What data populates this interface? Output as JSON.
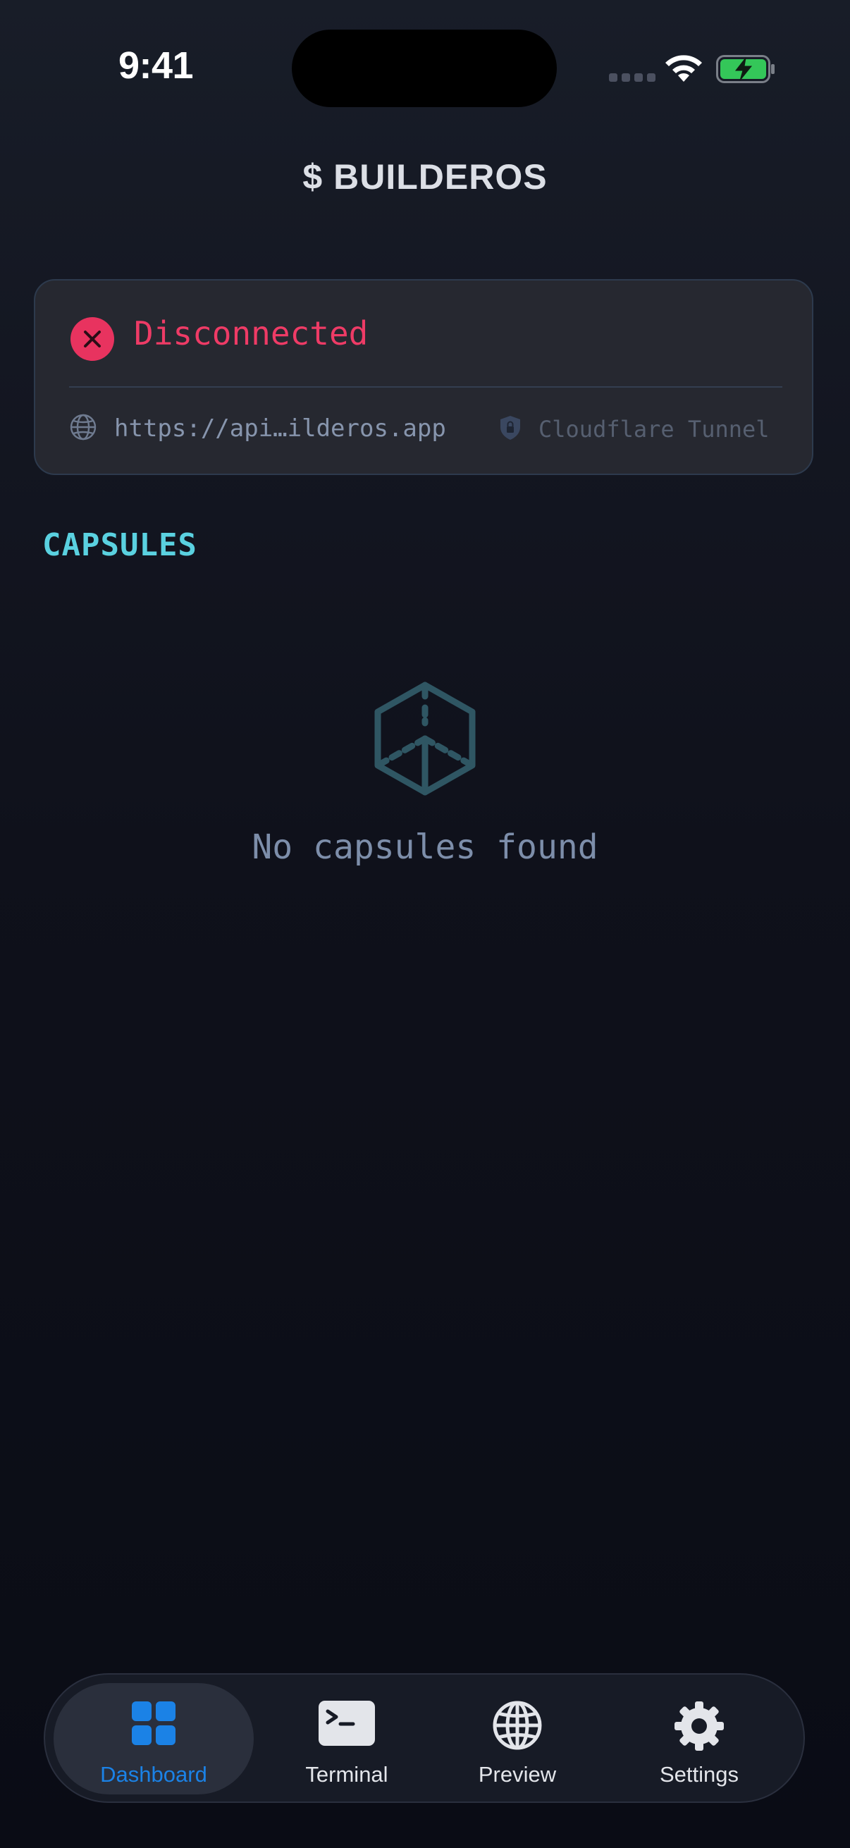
{
  "status_bar": {
    "time": "9:41"
  },
  "header": {
    "title": "$ BUILDEROS"
  },
  "connection": {
    "status": "Disconnected",
    "url": "https://api…ilderos.app",
    "tunnel": "Cloudflare Tunnel",
    "status_color": "#ee3b66"
  },
  "capsules": {
    "section_title": "CAPSULES",
    "empty_message": "No capsules found"
  },
  "tab_bar": {
    "tabs": [
      {
        "label": "Dashboard",
        "icon": "grid-icon",
        "active": true
      },
      {
        "label": "Terminal",
        "icon": "terminal-icon",
        "active": false
      },
      {
        "label": "Preview",
        "icon": "globe-icon",
        "active": false
      },
      {
        "label": "Settings",
        "icon": "gear-icon",
        "active": false
      }
    ]
  },
  "colors": {
    "accent": "#1b82e6",
    "section_title": "#5ad1e0",
    "error": "#e8335f"
  }
}
